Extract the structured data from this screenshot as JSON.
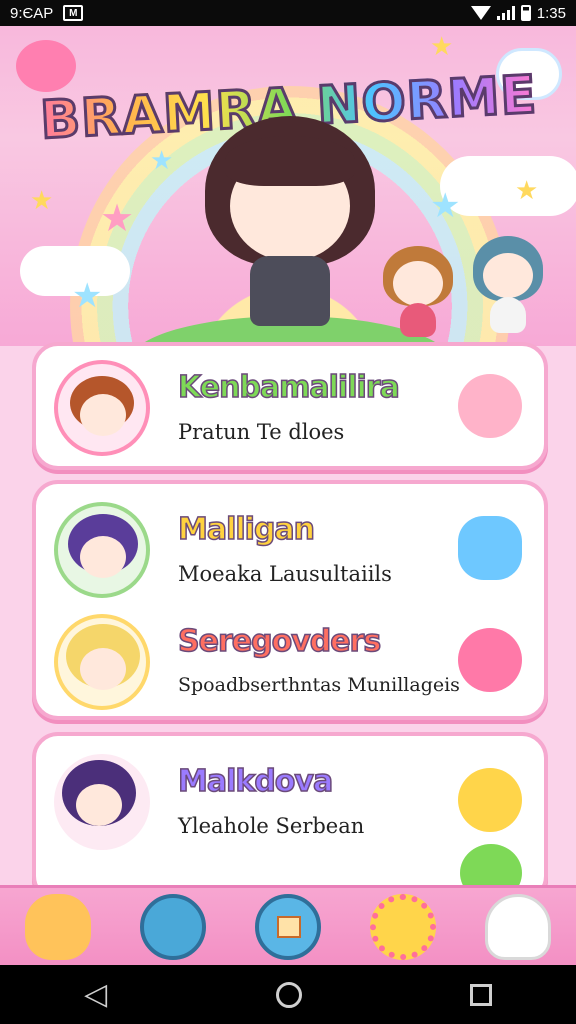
{
  "statusbar": {
    "left_text": "9:ЄАР",
    "app_badge": "M",
    "time": "1:35"
  },
  "hero": {
    "title": "BRAMRA NORME",
    "title_colors": [
      "#ff7a9e",
      "#ffb24d",
      "#ffe04d",
      "#7ed957",
      "#4dc3ff",
      "#9b7bff",
      "#ff7ad1"
    ]
  },
  "entries": [
    {
      "title": "Kenbamalilira",
      "subtitle": "Pratun Te dloes",
      "title_color": "#7ed957",
      "mascot_color": "#ffb3c9",
      "avatar_hair": "#b5562b",
      "avatar_bg": "#ffe7f2"
    },
    {
      "title": "Malligan",
      "subtitle": "Moeaka Lausultaiils",
      "title_color": "#ffd23f",
      "mascot_color": "#6ec8ff",
      "avatar_hair": "#5a3d9a",
      "avatar_bg": "#e8f7e4"
    },
    {
      "title": "Seregovders",
      "subtitle": "Spoadbserthntas Munillageis",
      "title_color": "#ff6f61",
      "mascot_color": "#ff79a8",
      "avatar_hair": "#f5d66a",
      "avatar_bg": "#fff6dc"
    },
    {
      "title": "Malkdova",
      "subtitle": "Yleahole Serbean",
      "title_color": "#9b7bff",
      "mascot_color": "#ffd54a",
      "avatar_hair": "#4b2f7a",
      "avatar_bg": "#fdeaf3"
    }
  ],
  "bottombar": {
    "icons": [
      "mascot-blob-icon",
      "edit-pen-icon",
      "calendar-icon",
      "flower-menu-icon",
      "ghost-pen-icon"
    ]
  },
  "navbar": {
    "icons": [
      "back-icon",
      "home-icon",
      "recents-icon"
    ]
  }
}
